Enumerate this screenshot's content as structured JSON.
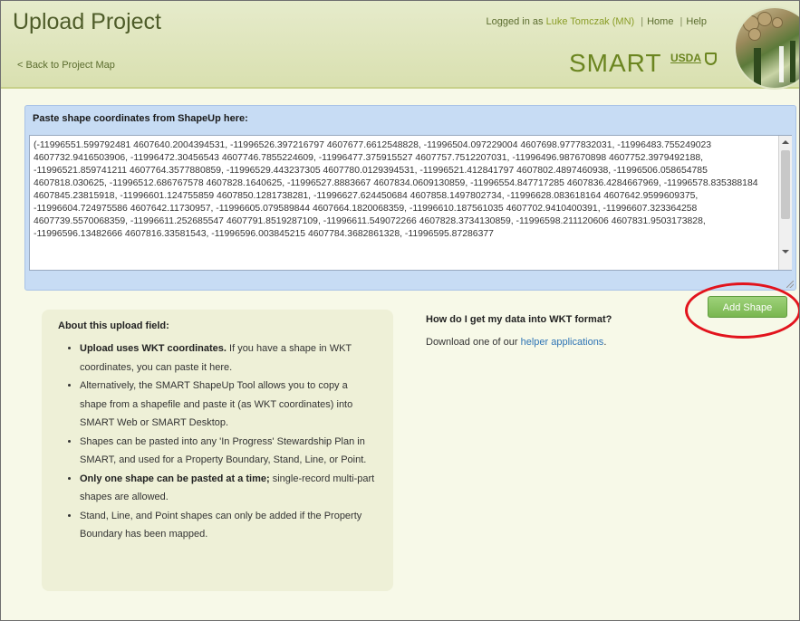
{
  "header": {
    "title": "Upload Project",
    "back_link": "< Back to Project Map",
    "logged_in_prefix": "Logged in as",
    "user": "Luke Tomczak (MN)",
    "home": "Home",
    "help": "Help",
    "brand": "SMART",
    "agency": "USDA"
  },
  "shape_input": {
    "label": "Paste shape coordinates from ShapeUp here:",
    "value": "(-11996551.599792481 4607640.2004394531, -11996526.397216797 4607677.6612548828, -11996504.097229004 4607698.9777832031, -11996483.755249023 4607732.9416503906, -11996472.30456543 4607746.7855224609, -11996477.375915527 4607757.7512207031, -11996496.987670898 4607752.3979492188, -11996521.859741211 4607764.3577880859, -11996529.443237305 4607780.0129394531, -11996521.412841797 4607802.4897460938, -11996506.058654785 4607818.030625, -11996512.686767578 4607828.1640625, -11996527.8883667 4607834.0609130859, -11996554.847717285 4607836.4284667969, -11996578.835388184 4607845.23815918, -11996601.124755859 4607850.1281738281, -11996627.624450684 4607858.1497802734, -11996628.083618164 4607642.9599609375, -11996604.724975586 4607642.11730957, -11996605.079589844 4607664.1820068359, -11996610.187561035 4607702.9410400391, -11996607.323364258 4607739.5570068359, -11996611.252685547 4607791.8519287109, -11996611.549072266 4607828.3734130859, -11996598.211120606 4607831.9503173828, -11996596.13482666 4607816.33581543, -11996596.003845215 4607784.3682861328, -11996595.87286377"
  },
  "actions": {
    "add_shape": "Add Shape"
  },
  "about": {
    "title": "About this upload field:",
    "items": [
      {
        "bold": "Upload uses WKT coordinates.",
        "text": " If you have a shape in WKT coordinates, you can paste it here."
      },
      {
        "bold": "",
        "text": "Alternatively, the SMART ShapeUp Tool allows you to copy a shape from a shapefile and paste it (as WKT coordinates) into SMART Web or SMART Desktop."
      },
      {
        "bold": "",
        "text": "Shapes can be pasted into any 'In Progress' Stewardship Plan in SMART, and used for a Property Boundary, Stand, Line, or Point."
      },
      {
        "bold": "Only one shape can be pasted at a time;",
        "text": " single-record multi-part shapes are allowed."
      },
      {
        "bold": "",
        "text": "Stand, Line, and Point shapes can only be added if the Property Boundary has been mapped."
      }
    ]
  },
  "wkt_help": {
    "title": "How do I get my data into WKT format?",
    "prefix": "Download one of our",
    "link": "helper applications",
    "suffix": "."
  },
  "colors": {
    "header_bg": "#dfe5bd",
    "title": "#4e5c29",
    "brand": "#6b8520",
    "panel_bg": "#c7dcf4",
    "button": "#79b64f",
    "annotation": "#e2141d"
  }
}
